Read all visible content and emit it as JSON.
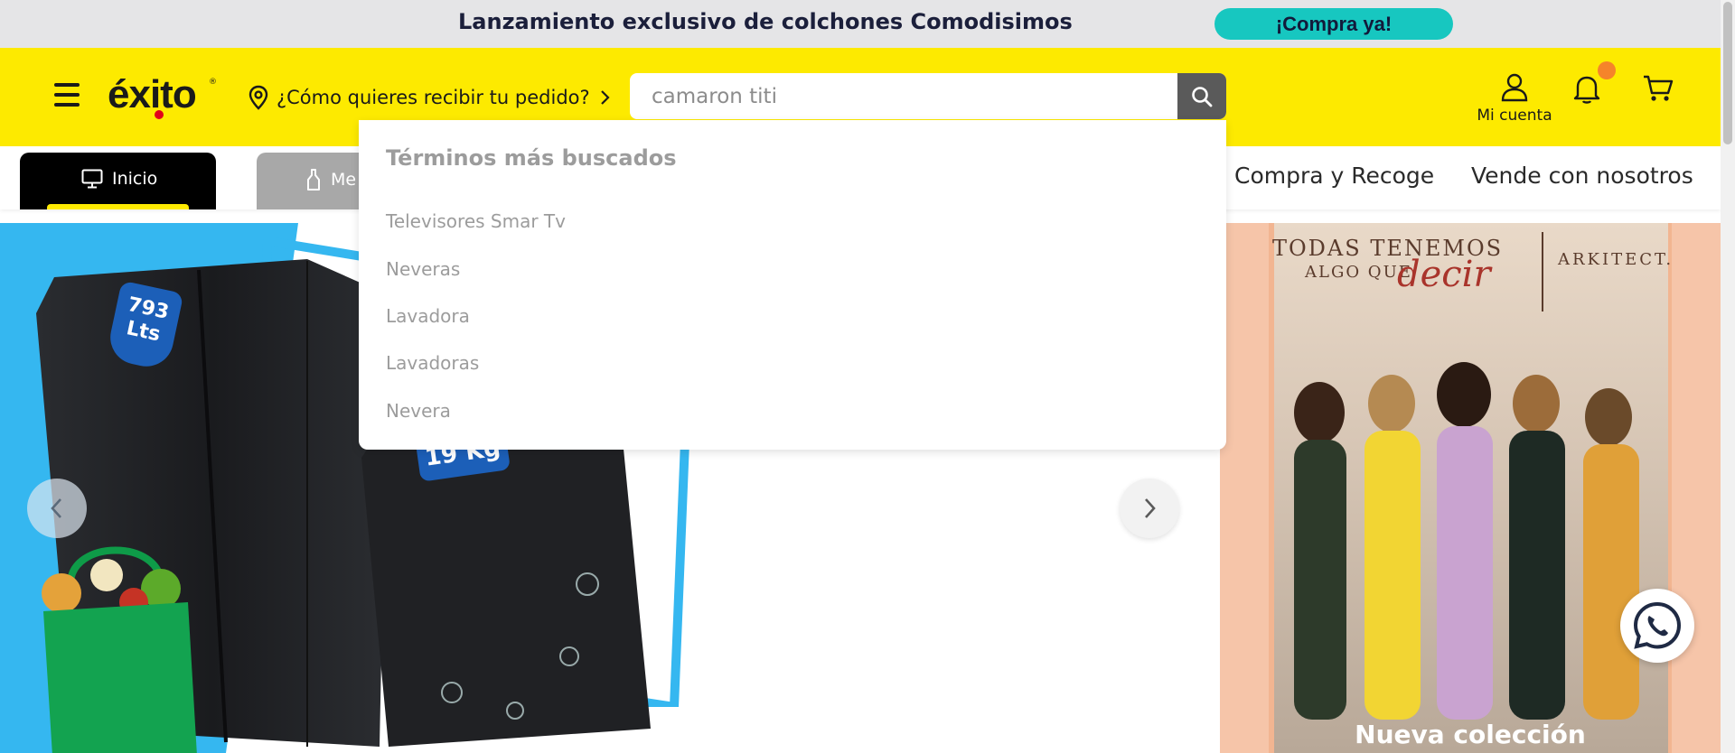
{
  "promo": {
    "text": "Lanzamiento exclusivo de colchones Comodisimos",
    "cta": "¡Compra ya!"
  },
  "header": {
    "logo": "éxito",
    "delivery_prompt": "¿Cómo quieres recibir tu pedido?",
    "search_value": "camaron titi",
    "account_label": "Mi cuenta"
  },
  "nav": {
    "tab_home": "Inicio",
    "tab_second_partial": "Me",
    "links": [
      "Compra y Recoge",
      "Vende con nosotros"
    ]
  },
  "search_dropdown": {
    "title": "Términos más buscados",
    "suggestions": [
      "Televisores Smar Tv",
      "Neveras",
      "Lavadora",
      "Lavadoras",
      "Nevera"
    ]
  },
  "banner": {
    "capacity_label": "793 Lts",
    "kg_label": "19 Kg"
  },
  "side_ad": {
    "headline_line1": "TODAS TENEMOS",
    "headline_line2": "ALGO QUE",
    "headline_script": "decir",
    "brand": "ARKITECT.",
    "cta": "Nueva colección"
  },
  "colors": {
    "header_yellow": "#fdea00",
    "promo_cta": "#17c7c0",
    "search_button": "#5a5a5a",
    "notification_dot": "#f5842a"
  },
  "icons": [
    "menu-icon",
    "location-pin-icon",
    "chevron-right-icon",
    "search-icon",
    "user-icon",
    "bell-icon",
    "cart-icon",
    "monitor-icon",
    "bottle-icon",
    "chevron-left-icon",
    "whatsapp-icon"
  ]
}
